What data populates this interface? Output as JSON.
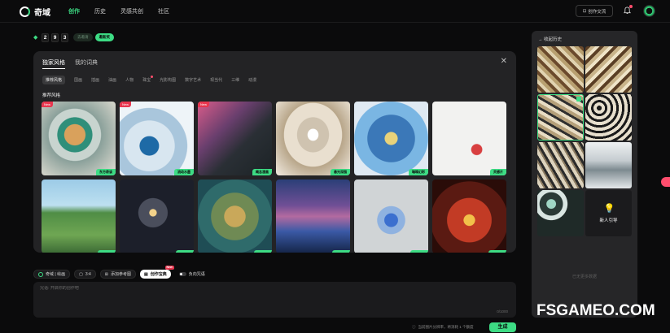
{
  "app": {
    "name": "奇域"
  },
  "nav": {
    "items": [
      "创作",
      "历史",
      "灵感共创",
      "社区"
    ],
    "active": "创作"
  },
  "header": {
    "create_exchange": "创作交流"
  },
  "counter": {
    "digits": [
      "2",
      "9",
      "3"
    ],
    "pill_dark": "去邀请",
    "pill_green": "邀新奖"
  },
  "panel": {
    "tabs": [
      "独家风格",
      "我的词典"
    ],
    "categories": [
      "推荐风格",
      "国画",
      "插画",
      "油画",
      "人物",
      "珠宝",
      "光影构图",
      "数字艺术",
      "现当代",
      "三维",
      "动漫"
    ],
    "section_title": "推荐风格",
    "cards": [
      {
        "label": "东方奇谈",
        "new": "New"
      },
      {
        "label": "流动水墨",
        "new": "New"
      },
      {
        "label": "概念漫画",
        "new": "New"
      },
      {
        "label": "悬光深园",
        "new": ""
      },
      {
        "label": "璀璨幻彩",
        "new": ""
      },
      {
        "label": "灵感片",
        "new": ""
      },
      {
        "label": "",
        "new": ""
      },
      {
        "label": "",
        "new": ""
      },
      {
        "label": "",
        "new": ""
      },
      {
        "label": "",
        "new": ""
      },
      {
        "label": "",
        "new": ""
      },
      {
        "label": "",
        "new": ""
      }
    ]
  },
  "toolbar": {
    "model": "奇域 | 绘画",
    "ratio": "3:4",
    "reference": "添加参考图",
    "treasure": "创作宝典",
    "treasure_badge": "New",
    "toggle_label": "负向咒语"
  },
  "prompt": {
    "placeholder": "咒语: 开启你的创作吧",
    "count": "0/1000"
  },
  "footer": {
    "note": "当前图片分辨率，将消耗 1 个额度",
    "generate": "生成"
  },
  "history": {
    "title": "收起历史",
    "card_text": "新人引导",
    "end_text": "已无更多数据"
  },
  "watermark": "FSGAMEO.COM",
  "colors": {
    "accent": "#3ddc84",
    "badge": "#e8364f",
    "panel": "#232325"
  }
}
